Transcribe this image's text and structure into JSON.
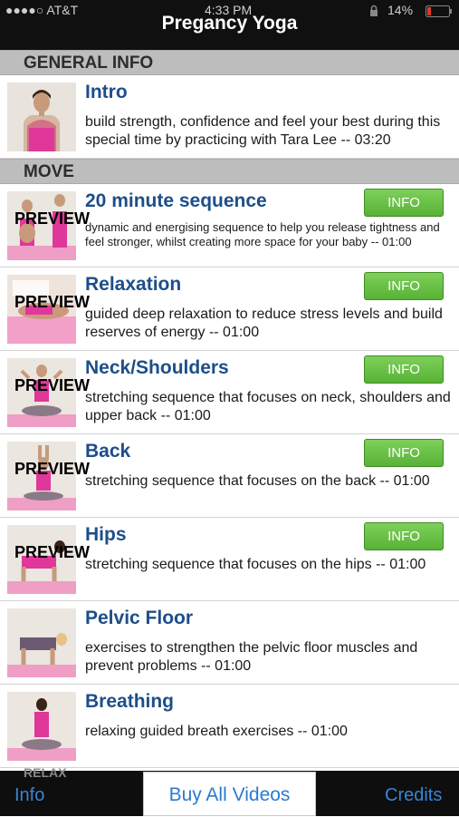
{
  "status_bar": {
    "carrier": "●●●●○ AT&T",
    "time": "4:33 PM",
    "battery": "14%"
  },
  "nav": {
    "title": "Pregancy Yoga"
  },
  "sections": [
    {
      "header": "GENERAL INFO",
      "rows": [
        {
          "title": "Intro",
          "description": "build strength, confidence and feel your best during this special time by practicing with Tara Lee -- 03:20",
          "preview": "",
          "info": ""
        }
      ]
    },
    {
      "header": "MOVE",
      "rows": [
        {
          "title": "20 minute sequence",
          "description": "dynamic and energising sequence to help you release tightness and feel stronger, whilst creating more space for your baby -- 01:00",
          "preview": "PREVIEW",
          "info": "INFO"
        },
        {
          "title": "Relaxation",
          "description": "guided deep relaxation to reduce stress levels and build reserves of energy -- 01:00",
          "preview": "PREVIEW",
          "info": "INFO"
        },
        {
          "title": "Neck/Shoulders",
          "description": "stretching sequence that focuses on neck, shoulders and upper back -- 01:00",
          "preview": "PREVIEW",
          "info": "INFO"
        },
        {
          "title": "Back",
          "description": "stretching sequence that focuses on the back -- 01:00",
          "preview": "PREVIEW",
          "info": "INFO"
        },
        {
          "title": "Hips",
          "description": "stretching sequence that focuses on the hips -- 01:00",
          "preview": "PREVIEW",
          "info": "INFO"
        },
        {
          "title": "Pelvic Floor",
          "description": "exercises to strengthen the pelvic floor muscles and prevent problems -- 01:00",
          "preview": "",
          "info": ""
        },
        {
          "title": "Breathing",
          "description": "relaxing guided breath exercises -- 01:00",
          "preview": "",
          "info": ""
        }
      ]
    }
  ],
  "next_section_peek": "RELAX",
  "tab_bar": {
    "info": "Info",
    "buy_all": "Buy All Videos",
    "credits": "Credits"
  },
  "colors": {
    "title_blue": "#1d4e89",
    "info_green": "#6cc24a",
    "tab_blue": "#3a84d6",
    "section_gray": "#bdbdbd"
  }
}
